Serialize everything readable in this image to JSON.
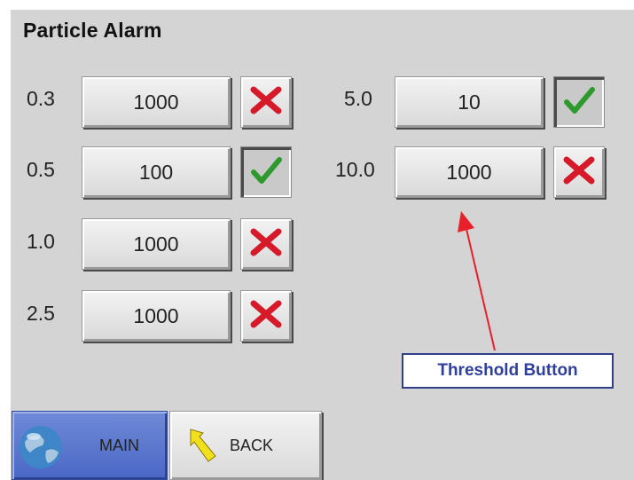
{
  "screen": {
    "title": "Particle Alarm"
  },
  "alarms_left": [
    {
      "size": "0.3",
      "threshold": "1000",
      "enabled": false
    },
    {
      "size": "0.5",
      "threshold": "100",
      "enabled": true
    },
    {
      "size": "1.0",
      "threshold": "1000",
      "enabled": false
    },
    {
      "size": "2.5",
      "threshold": "1000",
      "enabled": false
    }
  ],
  "alarms_right": [
    {
      "size": "5.0",
      "threshold": "10",
      "enabled": true
    },
    {
      "size": "10.0",
      "threshold": "1000",
      "enabled": false
    }
  ],
  "nav": {
    "main_label": "MAIN",
    "back_label": "BACK"
  },
  "annotation": {
    "label": "Threshold Button"
  },
  "icons": {
    "enabled": "check-icon",
    "disabled": "x-icon",
    "main": "globe-icon",
    "back": "back-arrow-icon"
  },
  "colors": {
    "check": "#2e9a2e",
    "cross": "#d61a2a",
    "main_button": "#4a67c6",
    "callout_text": "#2f3f9a",
    "arrow": "#e8202a"
  }
}
